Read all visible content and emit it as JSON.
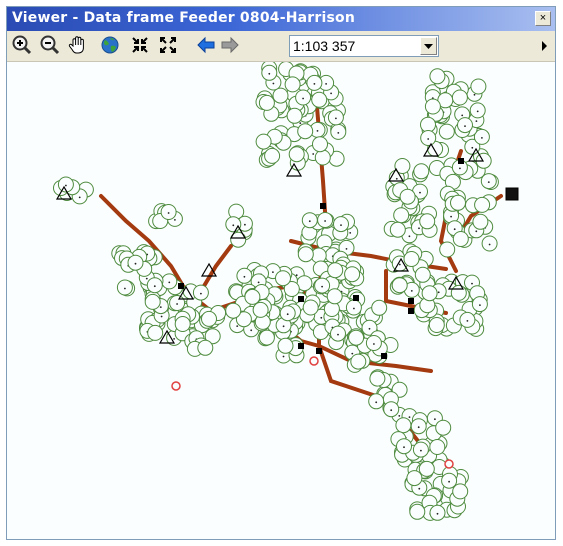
{
  "window": {
    "title": "Viewer - Data frame Feeder 0804-Harrison",
    "close_label": "×"
  },
  "toolbar": {
    "buttons": [
      {
        "name": "zoom-in-icon"
      },
      {
        "name": "zoom-out-icon"
      },
      {
        "name": "pan-hand-icon"
      },
      {
        "name": "full-extent-globe-icon"
      },
      {
        "name": "fixed-zoom-in-icon"
      },
      {
        "name": "fixed-zoom-out-icon"
      },
      {
        "name": "back-arrow-icon"
      },
      {
        "name": "forward-arrow-icon"
      }
    ],
    "scale_value": "1:103 357",
    "more_icon": "chevron-right-icon"
  },
  "map": {
    "node_color": "#4e8b3f",
    "line_color": "#a33a10",
    "symbol_color": "#000000",
    "marker_color": "#e04040"
  }
}
